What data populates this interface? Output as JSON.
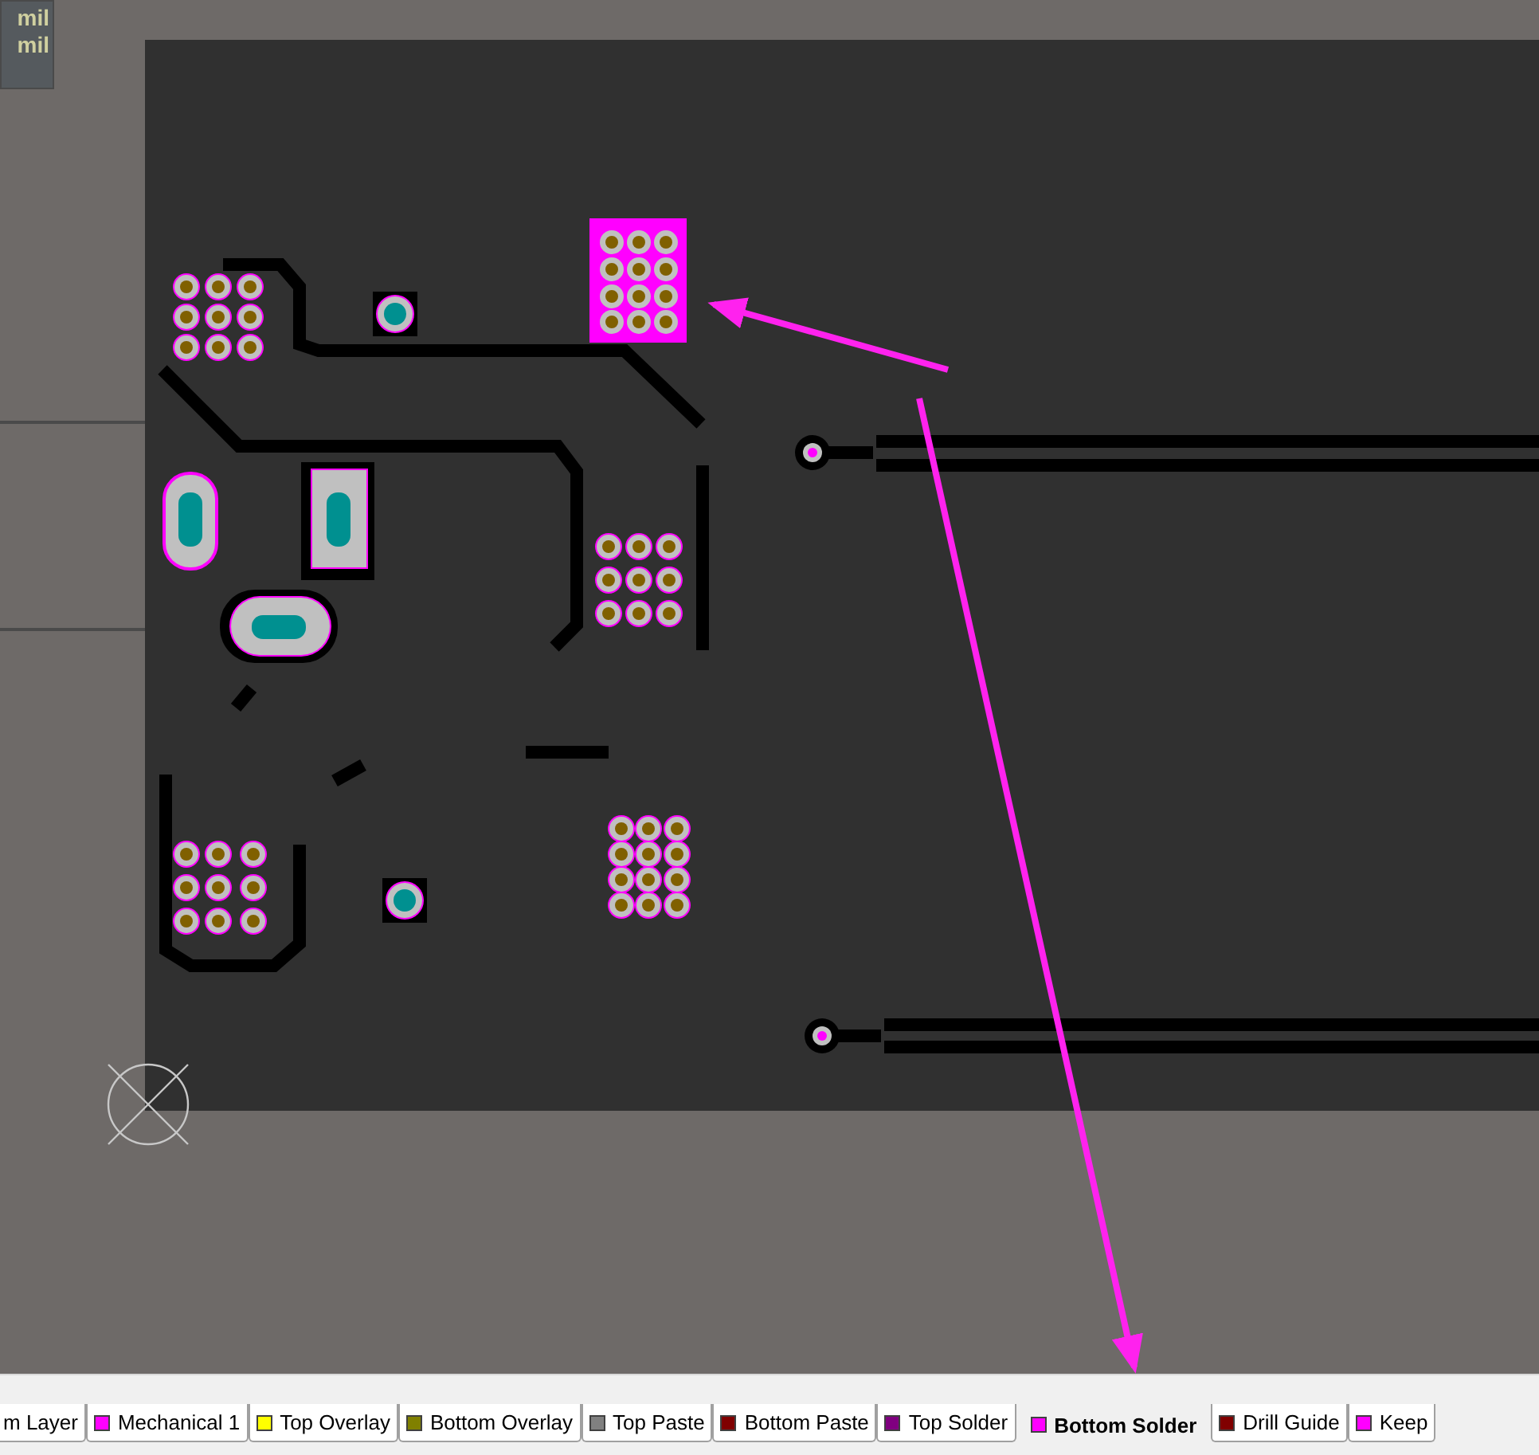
{
  "info_box": {
    "lines": [
      "mil",
      "mil"
    ]
  },
  "layer_tabs": [
    {
      "label": "m Layer",
      "selected": false
    },
    {
      "label": "Mechanical 1",
      "color": "#ff00ff",
      "selected": false
    },
    {
      "label": "Top Overlay",
      "color": "#ffff00",
      "selected": false
    },
    {
      "label": "Bottom Overlay",
      "color": "#808000",
      "selected": false
    },
    {
      "label": "Top Paste",
      "color": "#808080",
      "selected": false
    },
    {
      "label": "Bottom Paste",
      "color": "#800000",
      "selected": false
    },
    {
      "label": "Top Solder",
      "color": "#800080",
      "selected": false
    },
    {
      "label": "Bottom Solder",
      "color": "#ff00ff",
      "selected": true
    },
    {
      "label": "Drill Guide",
      "color": "#800000",
      "selected": false
    },
    {
      "label": "Keep",
      "color": "#ff00ff",
      "selected": false
    }
  ]
}
